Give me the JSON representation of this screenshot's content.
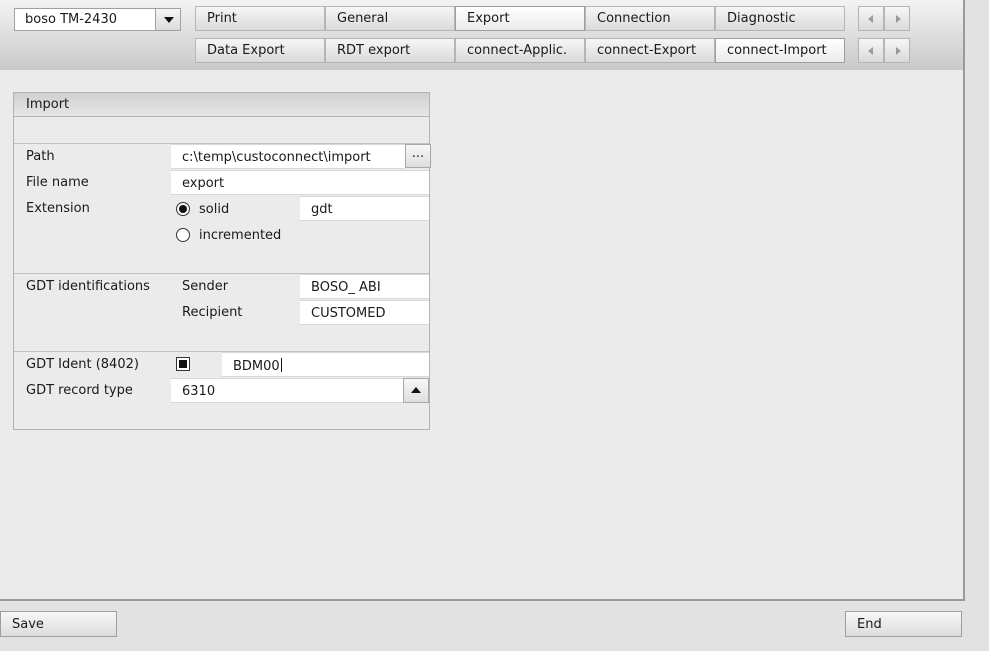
{
  "device_select": {
    "value": "boso TM-2430"
  },
  "tabs_row1": [
    "Print",
    "General",
    "Export",
    "Connection",
    "Diagnostic"
  ],
  "tabs_row2": [
    "Data Export",
    "RDT export",
    "connect-Applic.",
    "connect-Export",
    "connect-Import"
  ],
  "import_group": {
    "title": "Import",
    "path_label": "Path",
    "path_value": "c:\\temp\\custoconnect\\import",
    "browse_label": "...",
    "filename_label": "File name",
    "filename_value": "export",
    "extension_label": "Extension",
    "extension_options": [
      "solid",
      "incremented"
    ],
    "extension_selected": "solid",
    "extension_value": "gdt",
    "gdt_identifications_label": "GDT identifications",
    "sender_label": "Sender",
    "sender_value": "BOSO_ ABI",
    "recipient_label": "Recipient",
    "recipient_value": "CUSTOMED",
    "gdt_ident_label": "GDT Ident (8402)",
    "gdt_ident_checked": true,
    "gdt_ident_value": "BDM00",
    "gdt_record_type_label": "GDT record type",
    "gdt_record_type_value": "6310"
  },
  "footer": {
    "save_label": "Save",
    "end_label": "End"
  }
}
